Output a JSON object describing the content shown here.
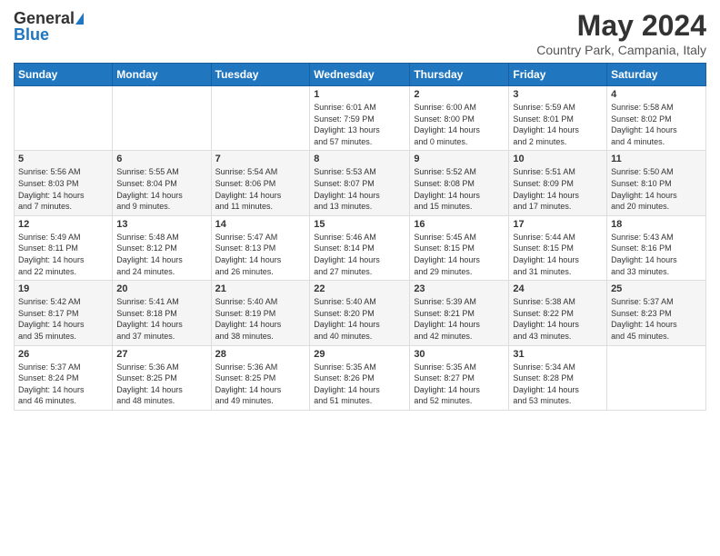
{
  "logo": {
    "line1": "General",
    "line2": "Blue"
  },
  "title": "May 2024",
  "subtitle": "Country Park, Campania, Italy",
  "headers": [
    "Sunday",
    "Monday",
    "Tuesday",
    "Wednesday",
    "Thursday",
    "Friday",
    "Saturday"
  ],
  "weeks": [
    [
      {
        "day": "",
        "info": ""
      },
      {
        "day": "",
        "info": ""
      },
      {
        "day": "",
        "info": ""
      },
      {
        "day": "1",
        "info": "Sunrise: 6:01 AM\nSunset: 7:59 PM\nDaylight: 13 hours\nand 57 minutes."
      },
      {
        "day": "2",
        "info": "Sunrise: 6:00 AM\nSunset: 8:00 PM\nDaylight: 14 hours\nand 0 minutes."
      },
      {
        "day": "3",
        "info": "Sunrise: 5:59 AM\nSunset: 8:01 PM\nDaylight: 14 hours\nand 2 minutes."
      },
      {
        "day": "4",
        "info": "Sunrise: 5:58 AM\nSunset: 8:02 PM\nDaylight: 14 hours\nand 4 minutes."
      }
    ],
    [
      {
        "day": "5",
        "info": "Sunrise: 5:56 AM\nSunset: 8:03 PM\nDaylight: 14 hours\nand 7 minutes."
      },
      {
        "day": "6",
        "info": "Sunrise: 5:55 AM\nSunset: 8:04 PM\nDaylight: 14 hours\nand 9 minutes."
      },
      {
        "day": "7",
        "info": "Sunrise: 5:54 AM\nSunset: 8:06 PM\nDaylight: 14 hours\nand 11 minutes."
      },
      {
        "day": "8",
        "info": "Sunrise: 5:53 AM\nSunset: 8:07 PM\nDaylight: 14 hours\nand 13 minutes."
      },
      {
        "day": "9",
        "info": "Sunrise: 5:52 AM\nSunset: 8:08 PM\nDaylight: 14 hours\nand 15 minutes."
      },
      {
        "day": "10",
        "info": "Sunrise: 5:51 AM\nSunset: 8:09 PM\nDaylight: 14 hours\nand 17 minutes."
      },
      {
        "day": "11",
        "info": "Sunrise: 5:50 AM\nSunset: 8:10 PM\nDaylight: 14 hours\nand 20 minutes."
      }
    ],
    [
      {
        "day": "12",
        "info": "Sunrise: 5:49 AM\nSunset: 8:11 PM\nDaylight: 14 hours\nand 22 minutes."
      },
      {
        "day": "13",
        "info": "Sunrise: 5:48 AM\nSunset: 8:12 PM\nDaylight: 14 hours\nand 24 minutes."
      },
      {
        "day": "14",
        "info": "Sunrise: 5:47 AM\nSunset: 8:13 PM\nDaylight: 14 hours\nand 26 minutes."
      },
      {
        "day": "15",
        "info": "Sunrise: 5:46 AM\nSunset: 8:14 PM\nDaylight: 14 hours\nand 27 minutes."
      },
      {
        "day": "16",
        "info": "Sunrise: 5:45 AM\nSunset: 8:15 PM\nDaylight: 14 hours\nand 29 minutes."
      },
      {
        "day": "17",
        "info": "Sunrise: 5:44 AM\nSunset: 8:15 PM\nDaylight: 14 hours\nand 31 minutes."
      },
      {
        "day": "18",
        "info": "Sunrise: 5:43 AM\nSunset: 8:16 PM\nDaylight: 14 hours\nand 33 minutes."
      }
    ],
    [
      {
        "day": "19",
        "info": "Sunrise: 5:42 AM\nSunset: 8:17 PM\nDaylight: 14 hours\nand 35 minutes."
      },
      {
        "day": "20",
        "info": "Sunrise: 5:41 AM\nSunset: 8:18 PM\nDaylight: 14 hours\nand 37 minutes."
      },
      {
        "day": "21",
        "info": "Sunrise: 5:40 AM\nSunset: 8:19 PM\nDaylight: 14 hours\nand 38 minutes."
      },
      {
        "day": "22",
        "info": "Sunrise: 5:40 AM\nSunset: 8:20 PM\nDaylight: 14 hours\nand 40 minutes."
      },
      {
        "day": "23",
        "info": "Sunrise: 5:39 AM\nSunset: 8:21 PM\nDaylight: 14 hours\nand 42 minutes."
      },
      {
        "day": "24",
        "info": "Sunrise: 5:38 AM\nSunset: 8:22 PM\nDaylight: 14 hours\nand 43 minutes."
      },
      {
        "day": "25",
        "info": "Sunrise: 5:37 AM\nSunset: 8:23 PM\nDaylight: 14 hours\nand 45 minutes."
      }
    ],
    [
      {
        "day": "26",
        "info": "Sunrise: 5:37 AM\nSunset: 8:24 PM\nDaylight: 14 hours\nand 46 minutes."
      },
      {
        "day": "27",
        "info": "Sunrise: 5:36 AM\nSunset: 8:25 PM\nDaylight: 14 hours\nand 48 minutes."
      },
      {
        "day": "28",
        "info": "Sunrise: 5:36 AM\nSunset: 8:25 PM\nDaylight: 14 hours\nand 49 minutes."
      },
      {
        "day": "29",
        "info": "Sunrise: 5:35 AM\nSunset: 8:26 PM\nDaylight: 14 hours\nand 51 minutes."
      },
      {
        "day": "30",
        "info": "Sunrise: 5:35 AM\nSunset: 8:27 PM\nDaylight: 14 hours\nand 52 minutes."
      },
      {
        "day": "31",
        "info": "Sunrise: 5:34 AM\nSunset: 8:28 PM\nDaylight: 14 hours\nand 53 minutes."
      },
      {
        "day": "",
        "info": ""
      }
    ]
  ]
}
